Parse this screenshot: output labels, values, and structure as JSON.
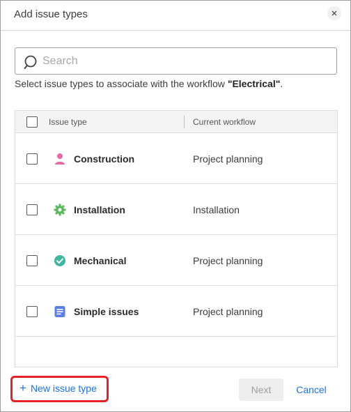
{
  "dialog": {
    "title": "Add issue types",
    "close_icon": "close-icon"
  },
  "search": {
    "placeholder": "Search",
    "value": "",
    "icon": "search-icon"
  },
  "instructions": {
    "prefix": "Select issue types to associate with the workflow ",
    "workflow_name": "\"Electrical\"",
    "suffix": "."
  },
  "table": {
    "columns": [
      "Issue type",
      "Current workflow"
    ],
    "rows": [
      {
        "name": "Construction",
        "workflow": "Project planning",
        "icon": "person-icon",
        "icon_color": "#e26aa8"
      },
      {
        "name": "Installation",
        "workflow": "Installation",
        "icon": "gear-icon",
        "icon_color": "#5cb85c"
      },
      {
        "name": "Mechanical",
        "workflow": "Project planning",
        "icon": "check-circle-icon",
        "icon_color": "#3fb5a3"
      },
      {
        "name": "Simple issues",
        "workflow": "Project planning",
        "icon": "document-icon",
        "icon_color": "#5b7fe8"
      }
    ]
  },
  "footer": {
    "new_issue_type_label": "New issue type",
    "next_label": "Next",
    "cancel_label": "Cancel"
  },
  "colors": {
    "accent": "#1a73e8",
    "highlight_outline": "#e8202a"
  }
}
